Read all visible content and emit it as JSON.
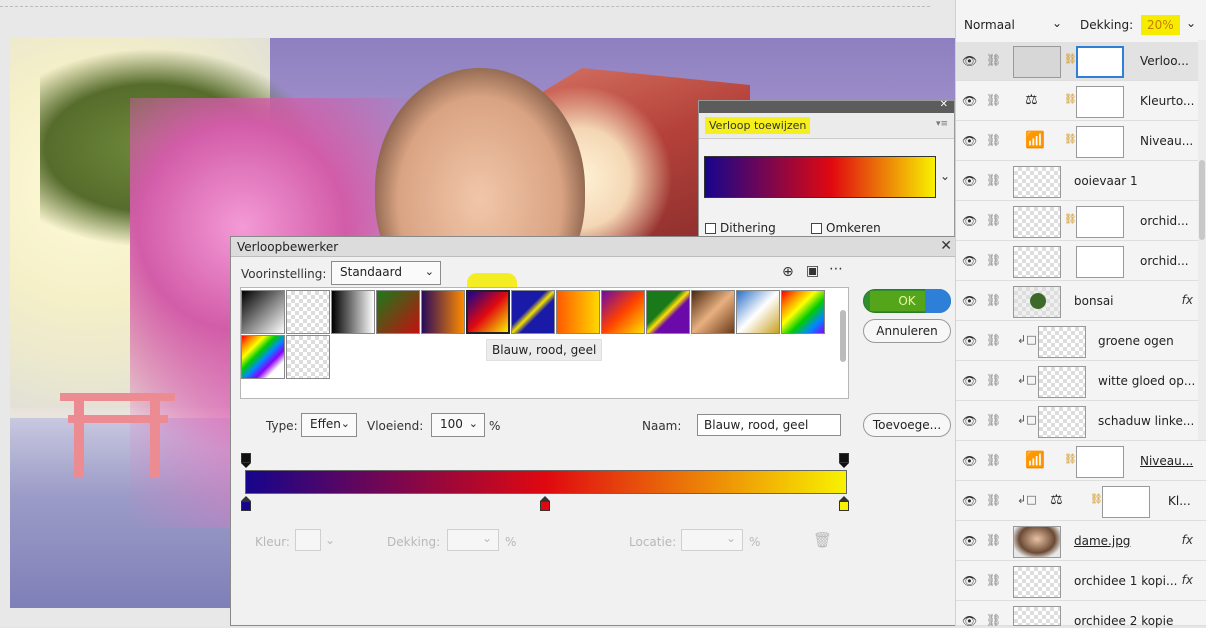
{
  "gradient_map": {
    "title": "Verloop toewijzen",
    "dithering_label": "Dithering",
    "reverse_label": "Omkeren"
  },
  "editor": {
    "title": "Verloopbewerker",
    "preset_label": "Voorinstelling:",
    "preset_value": "Standaard",
    "tooltip": "Blauw, rood, geel",
    "ok_label": "OK",
    "cancel_label": "Annuleren",
    "type_label": "Type:",
    "type_value": "Effen",
    "smooth_label": "Vloeiend:",
    "smooth_value": "100",
    "smooth_unit": "%",
    "name_label": "Naam:",
    "name_value": "Blauw, rood, geel",
    "add_label": "Toevoege...",
    "color_label": "Kleur:",
    "opacity_label": "Dekking:",
    "opacity_unit": "%",
    "location_label": "Locatie:",
    "location_unit": "%",
    "colors": {
      "blue": "#16058c",
      "red": "#e00810",
      "yellow": "#f8f200"
    }
  },
  "layers_panel": {
    "blend_mode": "Normaal",
    "opacity_label": "Dekking:",
    "opacity_value": "20%",
    "layers": [
      {
        "name": "Verloo...",
        "fx": ""
      },
      {
        "name": "Kleurto...",
        "fx": ""
      },
      {
        "name": "Niveau...",
        "fx": ""
      },
      {
        "name": "ooievaar 1",
        "fx": ""
      },
      {
        "name": "orchid...",
        "fx": ""
      },
      {
        "name": "orchid...",
        "fx": ""
      },
      {
        "name": "bonsai",
        "fx": "fx"
      },
      {
        "name": "groene ogen",
        "fx": ""
      },
      {
        "name": "witte gloed op...",
        "fx": ""
      },
      {
        "name": "schaduw linke...",
        "fx": ""
      },
      {
        "name": "Niveau...",
        "fx": ""
      },
      {
        "name": "Kl...",
        "fx": ""
      },
      {
        "name": "dame.jpg",
        "fx": "fx"
      },
      {
        "name": "orchidee 1 kopi...",
        "fx": "fx"
      },
      {
        "name": "orchidee 2 kopie",
        "fx": ""
      }
    ]
  }
}
